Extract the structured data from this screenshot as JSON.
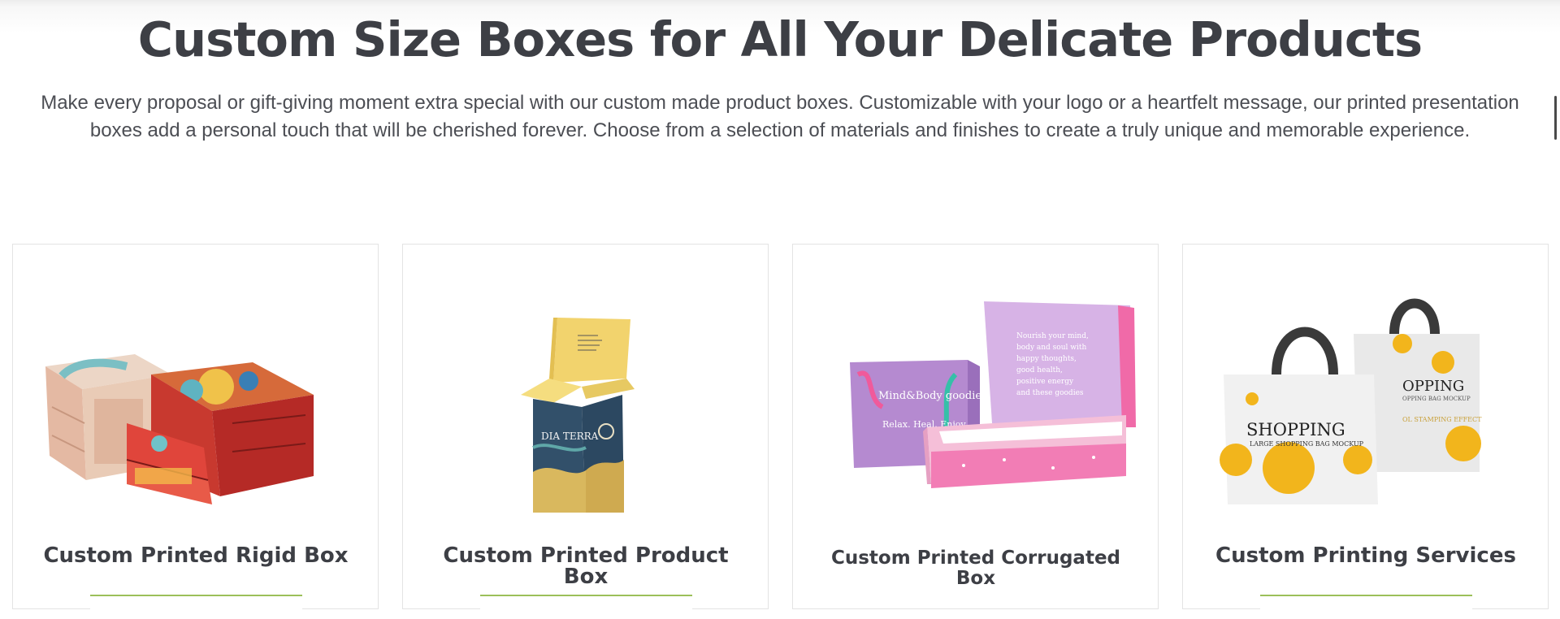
{
  "section": {
    "title": "Custom Size Boxes for All Your Delicate Products",
    "intro_line1": "Make every proposal or gift-giving moment extra special with our custom made product boxes. Customizable with your logo or a heartfelt message, our printed presentation",
    "intro_line2": "boxes add a personal touch that will be cherished forever. Choose from a selection of materials and finishes to create a truly unique and memorable experience."
  },
  "products": [
    {
      "title": "Custom Printed Rigid Box",
      "image": "rigid-drawer-box-image"
    },
    {
      "title": "Custom Printed Product Box",
      "image": "product-box-image",
      "box_text": "DIA TERRA"
    },
    {
      "title": "Custom Printed Corrugated Box",
      "image": "corrugated-mailer-box-image",
      "box_text": {
        "brand": "Mind&Body goodies",
        "tagline": "Relax. Heal. Enjoy",
        "lid_lines": [
          "Nourish your mind,",
          "body and soul with",
          "happy thoughts,",
          "good health,",
          "positive energy",
          "and these goodies"
        ]
      }
    },
    {
      "title": "Custom Printing Services",
      "image": "shopping-bag-image",
      "box_text": {
        "word": "SHOPPING",
        "back_word": "OPPING",
        "sub": "LARGE SHOPPING BAG MOCKUP",
        "back_sub": "OPPING BAG MOCKUP",
        "back_foil": "OL STAMPING EFFECT"
      }
    }
  ],
  "colors": {
    "heading": "#3d3f45",
    "button_accent": "#9bc05a",
    "card_border": "#e3e3e3"
  }
}
